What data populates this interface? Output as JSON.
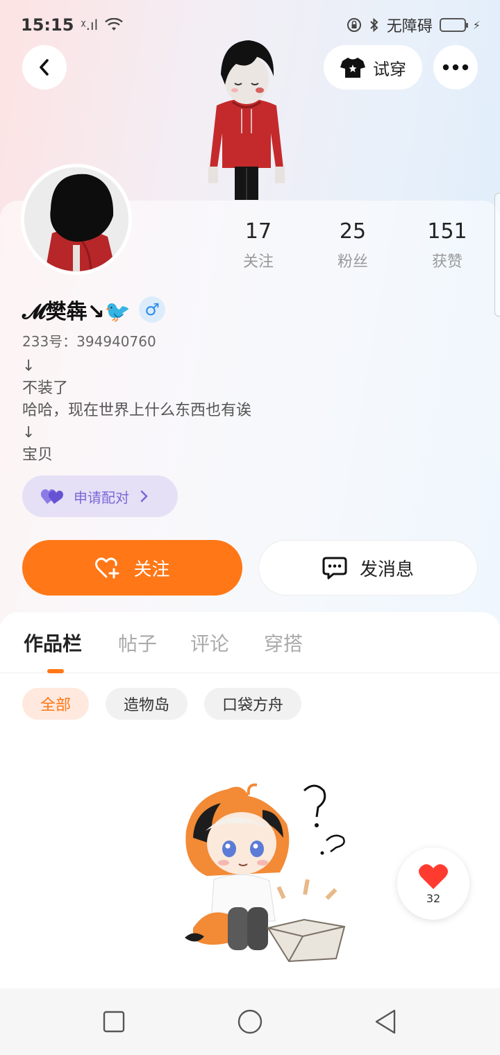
{
  "status_bar": {
    "time": "15:15",
    "signal": "ᵡ.ıl",
    "accessibility": "无障碍"
  },
  "header": {
    "try_on_label": "试穿"
  },
  "stats": [
    {
      "value": "17",
      "label": "关注"
    },
    {
      "value": "25",
      "label": "粉丝"
    },
    {
      "value": "151",
      "label": "获赞"
    }
  ],
  "profile": {
    "name": "𝓜樊犇↘🐦",
    "gender_symbol": "♂",
    "uid": "233号：394940760",
    "bio": "↓\n不装了\n哈哈，现在世界上什么东西也有诶\n↓\n宝贝"
  },
  "pair": {
    "label": "申请配对"
  },
  "actions": {
    "follow_label": "关注",
    "message_label": "发消息"
  },
  "tabs": [
    {
      "label": "作品栏"
    },
    {
      "label": "帖子"
    },
    {
      "label": "评论"
    },
    {
      "label": "穿搭"
    }
  ],
  "filters": [
    {
      "label": "全部"
    },
    {
      "label": "造物岛"
    },
    {
      "label": "口袋方舟"
    }
  ],
  "likes": {
    "count": "32"
  },
  "colors": {
    "accent": "#ff7716",
    "pair_bg": "#e6e0f6",
    "pair_text": "#7a68d8"
  }
}
